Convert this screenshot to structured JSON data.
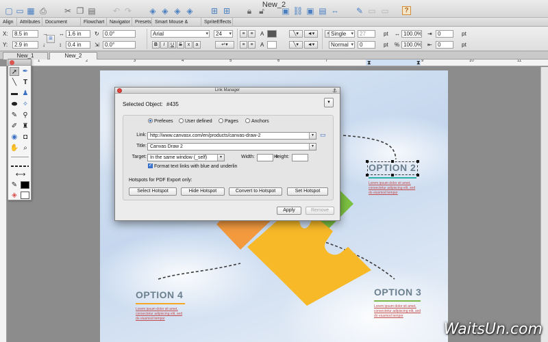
{
  "window": {
    "title": "New_2"
  },
  "toolbar": {
    "icons": [
      "new-document-icon",
      "open-icon",
      "save-icon",
      "print-icon",
      "cut-icon",
      "copy-icon",
      "paste-icon",
      "undo-icon",
      "redo-icon",
      "arrange-front-icon",
      "arrange-forward-icon",
      "arrange-backward-icon",
      "arrange-back-icon",
      "group-icon",
      "ungroup-icon",
      "lock-icon",
      "unlock-icon",
      "presentation-icon",
      "hyperlink-icon",
      "graphic-icon",
      "fit-icon",
      "edit-icon",
      "screen-icon",
      "comment-icon",
      "help-icon"
    ],
    "help_label": "?"
  },
  "palette_tabs": [
    "Align",
    "Attributes",
    "Document Layout",
    "Flowchart",
    "Navigator",
    "Presets",
    "Smart Mouse & Guides",
    "SpriteEffects"
  ],
  "properties": {
    "x_label": "X:",
    "x_value": "8.5 in",
    "y_label": "Y:",
    "y_value": "2.9 in",
    "w_value": "1.6 in",
    "h_value": "0.4 in",
    "angle1": "0.0°",
    "angle2": "0.0°",
    "font_name": "Arial",
    "font_size": "24",
    "bold": "B",
    "italic": "I",
    "underline": "U",
    "strike": "S",
    "line_spacing": "Single",
    "spacing_value": "27",
    "spacing_unit": "pt",
    "percent1": "100.0%",
    "num1": "0",
    "num1_unit": "pt",
    "style": "Normal",
    "style_value": "0",
    "style_unit": "pt",
    "percent2": "100.0%",
    "num2": "0",
    "num2_unit": "pt"
  },
  "document_tabs": [
    "New_1",
    "New_2"
  ],
  "ruler": {
    "numbers": [
      "1",
      "2",
      "3",
      "4",
      "5",
      "6",
      "7",
      "8",
      "9",
      "10",
      "11"
    ]
  },
  "canvas": {
    "option2": {
      "title": "OPTION 2",
      "text": "Lorem ipsum dolor sit amet, consectetur adipiscing elit, sed do eiusmod tempor"
    },
    "option3": {
      "title": "OPTION 3",
      "text": "Lorem ipsum dolor sit amet, consectetur adipiscing elit, sed do eiusmod tempor"
    },
    "option4": {
      "title": "OPTION 4",
      "text": "Lorem ipsum dolor sit amet, consectetur adipiscing elit, sed do eiusmod tempor"
    },
    "colors": {
      "option_title": "#6b7f8e",
      "teal_line": "#2ab0a7",
      "orange_line": "#f5a623",
      "green_line": "#7ab648",
      "puzzle_yellow": "#f7b928",
      "puzzle_green": "#7cc142",
      "puzzle_orange": "#f39a3f"
    }
  },
  "dialog": {
    "title": "Link Manager",
    "selected_label": "Selected Object:",
    "selected_value": "#435",
    "radios": [
      "Prefexes",
      "User defined",
      "Pages",
      "Anchors"
    ],
    "link_label": "Link:",
    "link_value": "http://www.canvasx.com/en/products/canvas-draw-2",
    "title_label": "Title:",
    "title_value": "Canvas Draw 2",
    "target_label": "Target:",
    "target_value": "In the same window (_self)",
    "width_label": "Width:",
    "height_label": "Height:",
    "format_label": "Format text links with blue and underlin",
    "hotspots_label": "Hotspots for PDF Export only:",
    "buttons": [
      "Select Hotspot",
      "Hide Hotspot",
      "Convert to Hotspot",
      "Set Hotspot"
    ],
    "apply": "Apply",
    "remove": "Remove"
  },
  "watermark": "WaitsUn.com"
}
